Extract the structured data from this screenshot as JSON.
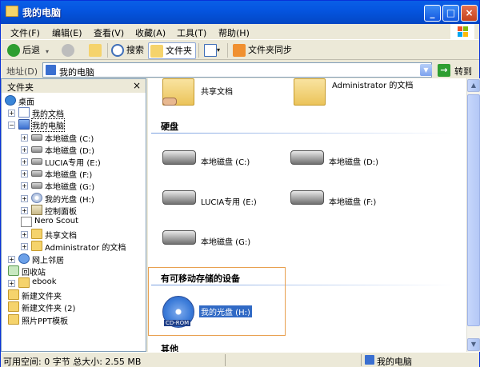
{
  "window": {
    "title": "我的电脑"
  },
  "menu": [
    "文件(F)",
    "编辑(E)",
    "查看(V)",
    "收藏(A)",
    "工具(T)",
    "帮助(H)"
  ],
  "toolbar": {
    "back": "后退",
    "search": "搜索",
    "folders": "文件夹",
    "sync": "文件夹同步"
  },
  "address": {
    "label": "地址(D)",
    "value": "我的电脑",
    "go": "转到"
  },
  "tree": {
    "header": "文件夹",
    "items": [
      {
        "label": "桌面",
        "icon": "desktop-icon"
      },
      {
        "label": "我的文档",
        "icon": "documents-icon"
      },
      {
        "label": "我的电脑",
        "icon": "computer-icon"
      },
      {
        "label": "本地磁盘 (C:)",
        "icon": "drive-icon"
      },
      {
        "label": "本地磁盘 (D:)",
        "icon": "drive-icon"
      },
      {
        "label": "LUCIA专用 (E:)",
        "icon": "drive-icon"
      },
      {
        "label": "本地磁盘 (F:)",
        "icon": "drive-icon"
      },
      {
        "label": "本地磁盘 (G:)",
        "icon": "drive-icon"
      },
      {
        "label": "我的光盘 (H:)",
        "icon": "cd-icon"
      },
      {
        "label": "控制面板",
        "icon": "control-panel-icon"
      },
      {
        "label": "Nero Scout",
        "icon": "nero-icon"
      },
      {
        "label": "共享文档",
        "icon": "folder-icon"
      },
      {
        "label": "Administrator 的文档",
        "icon": "folder-icon"
      },
      {
        "label": "网上邻居",
        "icon": "network-icon"
      },
      {
        "label": "回收站",
        "icon": "recycle-bin-icon"
      },
      {
        "label": "ebook",
        "icon": "folder-icon"
      },
      {
        "label": "新建文件夹",
        "icon": "folder-icon"
      },
      {
        "label": "新建文件夹 (2)",
        "icon": "folder-icon"
      },
      {
        "label": "照片PPT模板",
        "icon": "folder-icon"
      }
    ]
  },
  "content": {
    "shared": [
      {
        "label": "共享文档"
      },
      {
        "label": "Administrator 的文档"
      }
    ],
    "hdd_group": "硬盘",
    "drives": [
      {
        "label": "本地磁盘 (C:)"
      },
      {
        "label": "本地磁盘 (D:)"
      },
      {
        "label": "LUCIA专用 (E:)"
      },
      {
        "label": "本地磁盘 (F:)"
      },
      {
        "label": "本地磁盘 (G:)"
      }
    ],
    "removable_group": "有可移动存储的设备",
    "removable": [
      {
        "label": "我的光盘 (H:)",
        "badge": "CD-ROM"
      }
    ],
    "other_group": "其他"
  },
  "status": {
    "left": "可用空间: 0 字节 总大小: 2.55 MB",
    "right": "我的电脑"
  }
}
